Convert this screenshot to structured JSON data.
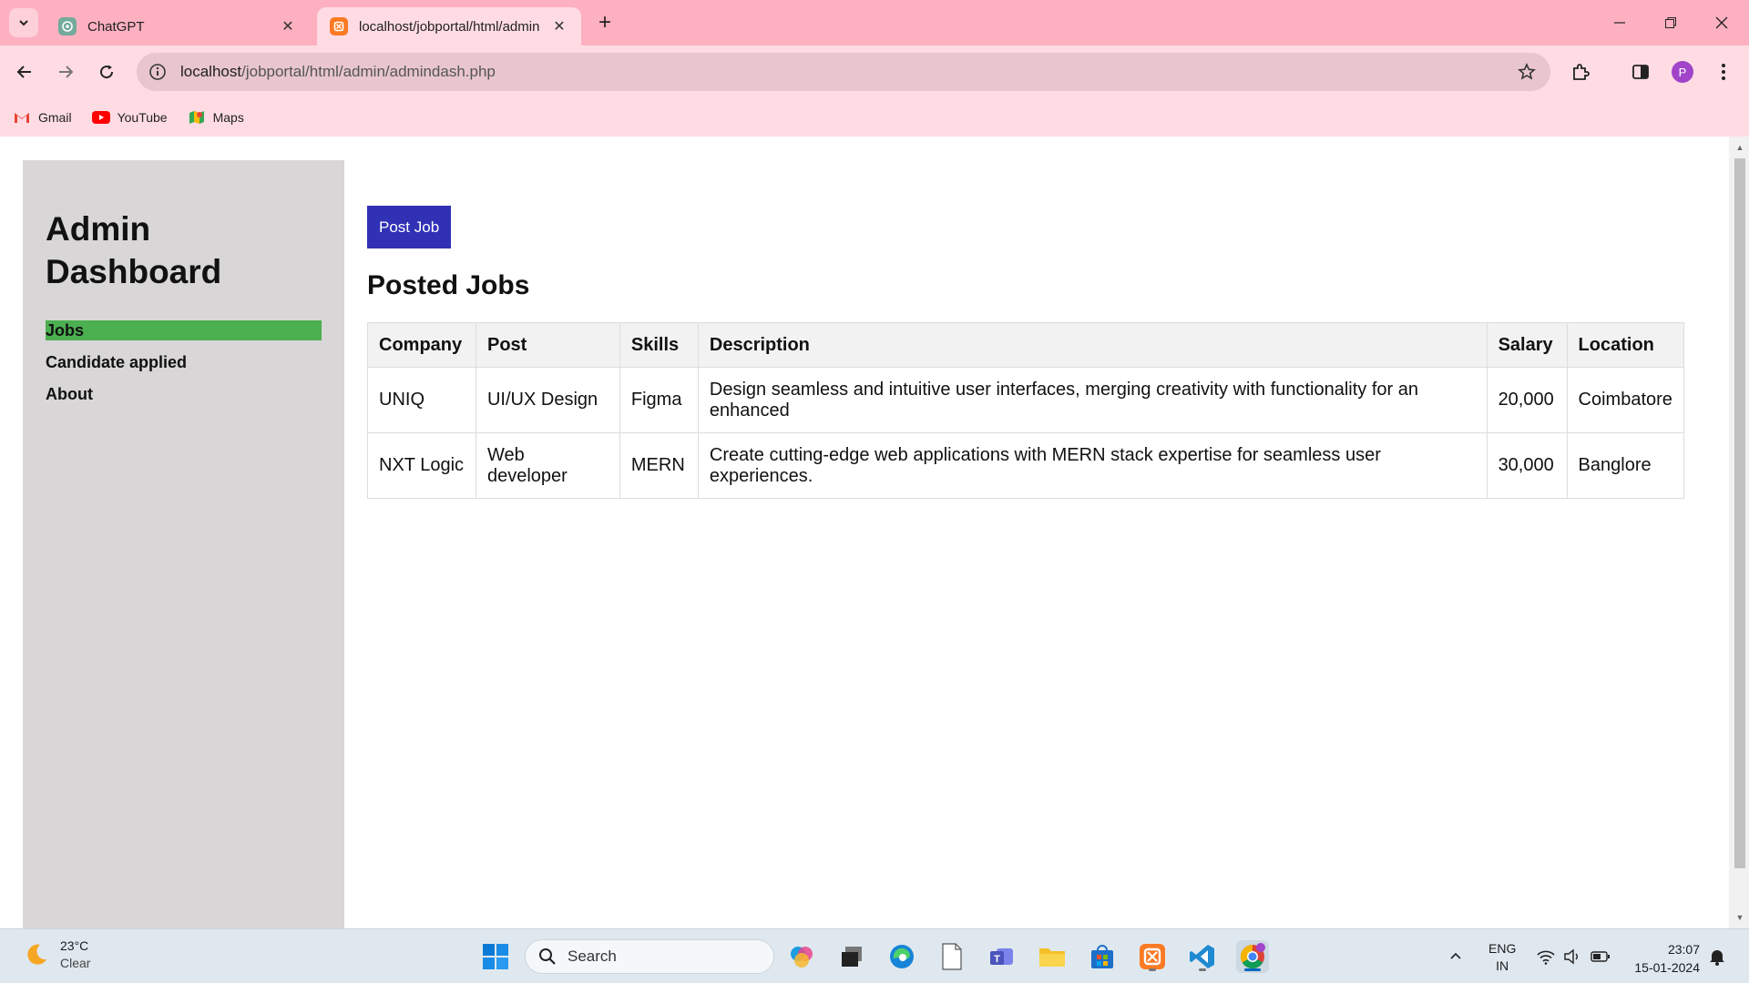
{
  "browser": {
    "tabs": [
      {
        "title": "ChatGPT",
        "active": false,
        "icon": "chatgpt-icon"
      },
      {
        "title": "localhost/jobportal/html/admin",
        "active": true,
        "icon": "xampp-icon"
      }
    ],
    "url_host": "localhost",
    "url_path": "/jobportal/html/admin/admindash.php",
    "profile_initial": "P",
    "bookmarks": [
      {
        "label": "Gmail",
        "icon": "gmail-icon"
      },
      {
        "label": "YouTube",
        "icon": "youtube-icon"
      },
      {
        "label": "Maps",
        "icon": "maps-icon"
      }
    ]
  },
  "sidebar": {
    "title_line1": "Admin",
    "title_line2": "Dashboard",
    "items": [
      {
        "label": "Jobs",
        "active": true
      },
      {
        "label": "Candidate applied",
        "active": false
      },
      {
        "label": "About",
        "active": false
      }
    ]
  },
  "main": {
    "post_button": "Post Job",
    "heading": "Posted Jobs",
    "columns": [
      "Company",
      "Post",
      "Skills",
      "Description",
      "Salary",
      "Location"
    ],
    "rows": [
      {
        "company": "UNIQ",
        "post": "UI/UX Design",
        "skills": "Figma",
        "description": "Design seamless and intuitive user interfaces, merging creativity with functionality for an enhanced",
        "salary": "20,000",
        "location": "Coimbatore"
      },
      {
        "company": "NXT Logic",
        "post": "Web developer",
        "skills": "MERN",
        "description": "Create cutting-edge web applications with MERN stack expertise for seamless user experiences.",
        "salary": "30,000",
        "location": "Banglore"
      }
    ]
  },
  "taskbar": {
    "weather_temp": "23°C",
    "weather_cond": "Clear",
    "search_placeholder": "Search",
    "lang_line1": "ENG",
    "lang_line2": "IN",
    "time": "23:07",
    "date": "15-01-2024"
  },
  "colors": {
    "tabbar": "#fdb0c0",
    "toolbar": "#ffdce4",
    "sidebar_bg": "#d8d6d7",
    "active_nav": "#4caf50",
    "post_button": "#3131b6"
  }
}
